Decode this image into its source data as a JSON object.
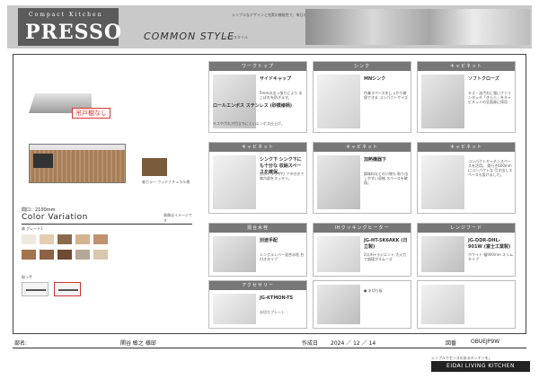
{
  "header": {
    "brand_sub": "Compact Kitchen",
    "brand": "PRESSO",
    "style_name": "COMMON STYLE",
    "style_small": "コモンスタイル",
    "note": "シンプルなデザインと充実の機能性で、毎日のキッチンを快適に。"
  },
  "left": {
    "hood_tag": "吊戸棚なし",
    "swatch_label": "扉カラー ウッドナチュラル柄",
    "dims": "間口：2100mm",
    "cv_title": "Color Variation",
    "cv_note": "画像はイメージです",
    "grade_label": "扉 グレード1",
    "handle_label": "取っ手",
    "chip_colors": [
      "#efe9e0",
      "#e2cdb0",
      "#8a6a4c",
      "#d3b48e",
      "#c09270",
      "#a3744f",
      "#8d6242",
      "#6e4b32",
      "#b5a796",
      "#d9c7ad"
    ]
  },
  "cells": [
    {
      "header": "ワークトップ",
      "title": "サイドキャップ",
      "body": "5mmの出っ張りにより 水こぼれを防ぎます。",
      "title2": "ロールエンボス ステンレス (砂模様柄)",
      "body2": "キズや汚れが目立ちにくいエンボス仕上げ。"
    },
    {
      "header": "シンク",
      "title": "MNシンク",
      "body": "作業スペースをしっかり確保できる コンパクトサイズ"
    },
    {
      "header": "キャビネット",
      "title": "ソフトクローズ",
      "body": "キズ・油汚れに強いファインタッチ「きらら」をキャビネットの全面扉に採用"
    },
    {
      "header": "キャビネット",
      "title": "シンク下 シンク下にも十分な 収納スペースを確保。",
      "body": "排水トラップ付 フタ付きで扉内部をスッキリ。"
    },
    {
      "header": "キャビネット",
      "title": "加熱機器下",
      "body": "調味料などの小物も 取り出しやすい収納 スペースを確保。"
    },
    {
      "header": "キャビネット",
      "title": "",
      "body": "コンパクトキッチンスペースを活用。 奥行き600mmにコンパクトな 引き出しスペースも設けました。"
    },
    {
      "header": "混合水栓",
      "title": "別途手配",
      "body": "シングルレバー混合水栓 台付きタイプ"
    },
    {
      "header": "IHクッキングヒーター",
      "title": "JG-HT-SK6AKK (日立製)",
      "body": "2口IH+ラジエント 大火力で調理がスムーズ"
    },
    {
      "header": "レンジフード",
      "title": "JG-DDR-DHL-901W (富士工業製)",
      "body": "ホワイト 幅900mm スリムタイプ"
    },
    {
      "header": "アクセサリー",
      "title": "JG-KTMON-TS",
      "body": "水切りプレート"
    },
    {
      "header": "",
      "title": "",
      "body": "● 水切り板"
    },
    {
      "header": "",
      "title": "",
      "body": ""
    }
  ],
  "footer": {
    "dept_label": "部名:",
    "customer": "関谷 敏之 様邸",
    "date_label": "作成日",
    "date": "2024 ／ 12 ／ 14",
    "code_label": "図番",
    "code": "OBUEJP9W"
  },
  "company_tag": "シンプルでセンスのあるキッチンを。",
  "company": "EIDAI LIVING KITCHEN"
}
